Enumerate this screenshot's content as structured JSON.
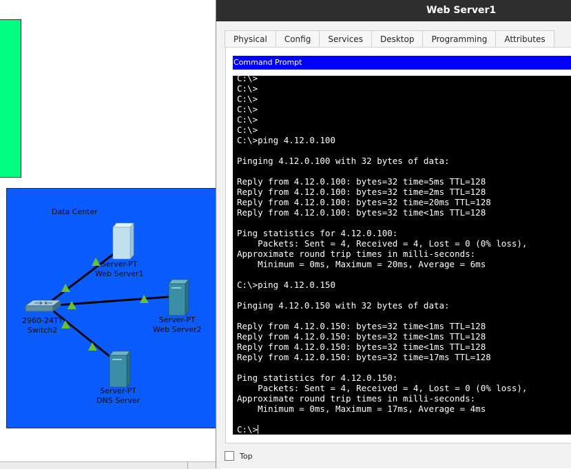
{
  "topology": {
    "data_center_label": "Data Center",
    "devices": [
      {
        "id": "web1",
        "type": "Server-PT",
        "name": "Web Server1"
      },
      {
        "id": "web2",
        "type": "Server-PT",
        "name": "Web Server2"
      },
      {
        "id": "dns",
        "type": "Server-PT",
        "name": "DNS Server"
      },
      {
        "id": "switch",
        "type": "2960-24TT",
        "name": "Switch2"
      }
    ],
    "colors": {
      "green_area": "#00ff80",
      "data_center": "#0a5cff",
      "link_up": "#6abf3a",
      "server_body": "#3a8fa6",
      "server_web1": "#bfe0ee"
    }
  },
  "window": {
    "title": "Web Server1",
    "tabs": [
      "Physical",
      "Config",
      "Services",
      "Desktop",
      "Programming",
      "Attributes"
    ],
    "active_tab": "Desktop",
    "panel_title": "Command Prompt",
    "top_checkbox_label": "Top",
    "top_checked": false
  },
  "terminal": {
    "lines": [
      "C:\\>",
      "C:\\>",
      "C:\\>",
      "C:\\>",
      "C:\\>",
      "C:\\>",
      "C:\\>ping 4.12.0.100",
      "",
      "Pinging 4.12.0.100 with 32 bytes of data:",
      "",
      "Reply from 4.12.0.100: bytes=32 time=5ms TTL=128",
      "Reply from 4.12.0.100: bytes=32 time=2ms TTL=128",
      "Reply from 4.12.0.100: bytes=32 time=20ms TTL=128",
      "Reply from 4.12.0.100: bytes=32 time<1ms TTL=128",
      "",
      "Ping statistics for 4.12.0.100:",
      "    Packets: Sent = 4, Received = 4, Lost = 0 (0% loss),",
      "Approximate round trip times in milli-seconds:",
      "    Minimum = 0ms, Maximum = 20ms, Average = 6ms",
      "",
      "C:\\>ping 4.12.0.150",
      "",
      "Pinging 4.12.0.150 with 32 bytes of data:",
      "",
      "Reply from 4.12.0.150: bytes=32 time<1ms TTL=128",
      "Reply from 4.12.0.150: bytes=32 time<1ms TTL=128",
      "Reply from 4.12.0.150: bytes=32 time<1ms TTL=128",
      "Reply from 4.12.0.150: bytes=32 time=17ms TTL=128",
      "",
      "Ping statistics for 4.12.0.150:",
      "    Packets: Sent = 4, Received = 4, Lost = 0 (0% loss),",
      "Approximate round trip times in milli-seconds:",
      "    Minimum = 0ms, Maximum = 17ms, Average = 4ms",
      ""
    ],
    "prompt": "C:\\>"
  }
}
